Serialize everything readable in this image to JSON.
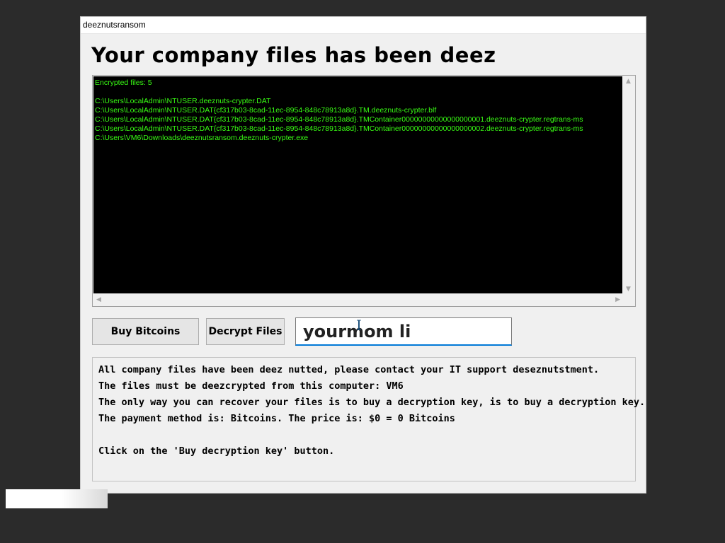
{
  "window": {
    "title": "deeznutsransom"
  },
  "heading": "Your company files has been deez",
  "console": {
    "header": "Encrypted files: 5",
    "files": [
      "C:\\Users\\LocalAdmin\\NTUSER.deeznuts-crypter.DAT",
      "C:\\Users\\LocalAdmin\\NTUSER.DAT{cf317b03-8cad-11ec-8954-848c78913a8d}.TM.deeznuts-crypter.blf",
      "C:\\Users\\LocalAdmin\\NTUSER.DAT{cf317b03-8cad-11ec-8954-848c78913a8d}.TMContainer00000000000000000001.deeznuts-crypter.regtrans-ms",
      "C:\\Users\\LocalAdmin\\NTUSER.DAT{cf317b03-8cad-11ec-8954-848c78913a8d}.TMContainer00000000000000000002.deeznuts-crypter.regtrans-ms",
      "C:\\Users\\VM6\\Downloads\\deeznutsransom.deeznuts-crypter.exe"
    ]
  },
  "buttons": {
    "buy": "Buy Bitcoins",
    "decrypt": "Decrypt Files"
  },
  "key_input": {
    "value": "yourmom li"
  },
  "message": {
    "lines": [
      "All company files have been deez nutted, please contact your IT support deseznutstment.",
      "The files must be deezcrypted from this computer: VM6",
      "The only way you can recover your files is to buy a decryption key, is to buy a decryption key.",
      "The payment method is: Bitcoins.  The price is: $0 = 0 Bitcoins",
      "",
      "Click on the 'Buy decryption key' button."
    ]
  },
  "colors": {
    "console_text": "#39ff14",
    "console_bg": "#000000",
    "input_focus": "#0078d7"
  }
}
